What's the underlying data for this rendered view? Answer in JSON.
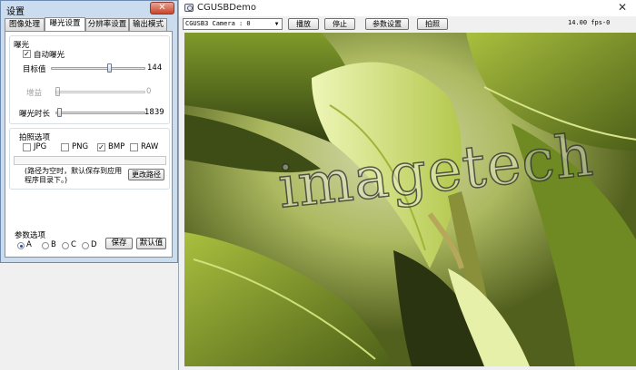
{
  "settings": {
    "title": "设置",
    "tabs": [
      {
        "label": "图像处理"
      },
      {
        "label": "曝光设置"
      },
      {
        "label": "分辨率设置"
      },
      {
        "label": "输出模式"
      }
    ],
    "exposure": {
      "group_label": "曝光",
      "auto_label": "自动曝光",
      "auto_checked": true,
      "target_label": "目标值",
      "target_value": "144",
      "gain_label": "增益",
      "gain_value": "0",
      "time_label": "曝光时长",
      "time_value": "1839"
    },
    "capture": {
      "group_label": "拍照选项",
      "formats": [
        {
          "label": "JPG",
          "checked": false
        },
        {
          "label": "PNG",
          "checked": false
        },
        {
          "label": "BMP",
          "checked": true
        },
        {
          "label": "RAW",
          "checked": false
        }
      ],
      "note": "(路径为空时，默认保存到应用程序目录下。)",
      "path_button": "更改路径"
    },
    "params": {
      "label": "参数选项",
      "options": [
        {
          "label": "A",
          "selected": true
        },
        {
          "label": "B",
          "selected": false
        },
        {
          "label": "C",
          "selected": false
        },
        {
          "label": "D",
          "selected": false
        }
      ],
      "save_button": "保存",
      "default_button": "默认值"
    }
  },
  "main": {
    "title": "CGUSBDemo",
    "close_glyph": "✕",
    "camera_select": "CGUSB3 Camera : 0",
    "buttons": {
      "play": "播放",
      "stop": "停止",
      "params": "参数设置",
      "snapshot": "拍照"
    },
    "fps": "14.00 fps-0",
    "watermark": "imagetech"
  }
}
